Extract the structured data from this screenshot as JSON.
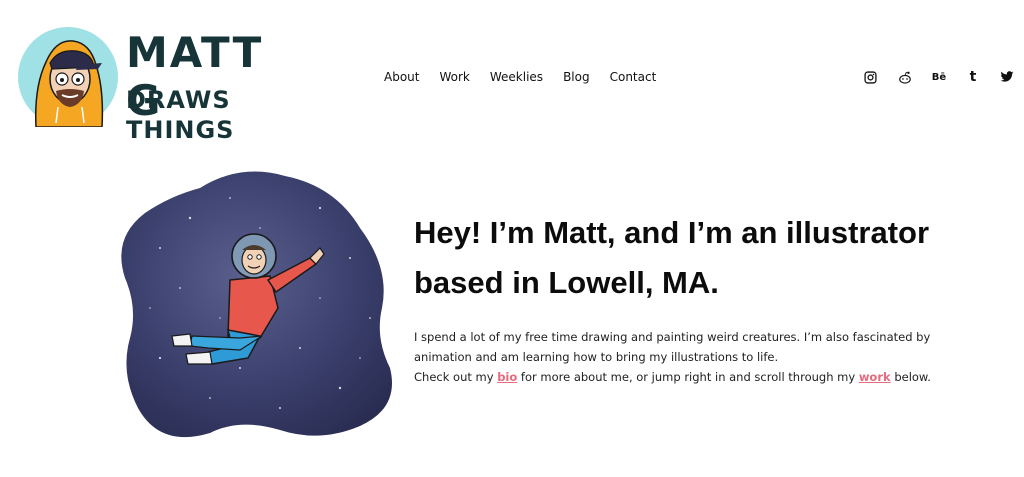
{
  "brand": {
    "line1": "MATT G",
    "line2": "DRAWS THINGS",
    "color": "#173538",
    "avatar_bg": "#9fe1e4",
    "hoodie_color": "#f5a623"
  },
  "nav": {
    "items": [
      {
        "label": "About"
      },
      {
        "label": "Work"
      },
      {
        "label": "Weeklies"
      },
      {
        "label": "Blog"
      },
      {
        "label": "Contact"
      }
    ]
  },
  "social": {
    "icons": [
      "instagram-icon",
      "reddit-icon",
      "behance-icon",
      "tumblr-icon",
      "twitter-icon"
    ],
    "behance_text": "Bē",
    "tumblr_text": "t"
  },
  "hero": {
    "headline_line1": "Hey! I’m Matt, and I’m an illustrator",
    "headline_line2": "based in Lowell, MA.",
    "para1": "I spend a lot of my free time drawing and painting weird creatures. I’m also fascinated by animation and am learning how to bring my illustrations to life.",
    "para2_start": "Check out my ",
    "bio_link": "bio",
    "para2_mid": " for more about me, or jump right in and scroll through my ",
    "work_link": "work",
    "para2_end": " below.",
    "link_color": "#e56b7e",
    "space_color": "#2f3560"
  }
}
